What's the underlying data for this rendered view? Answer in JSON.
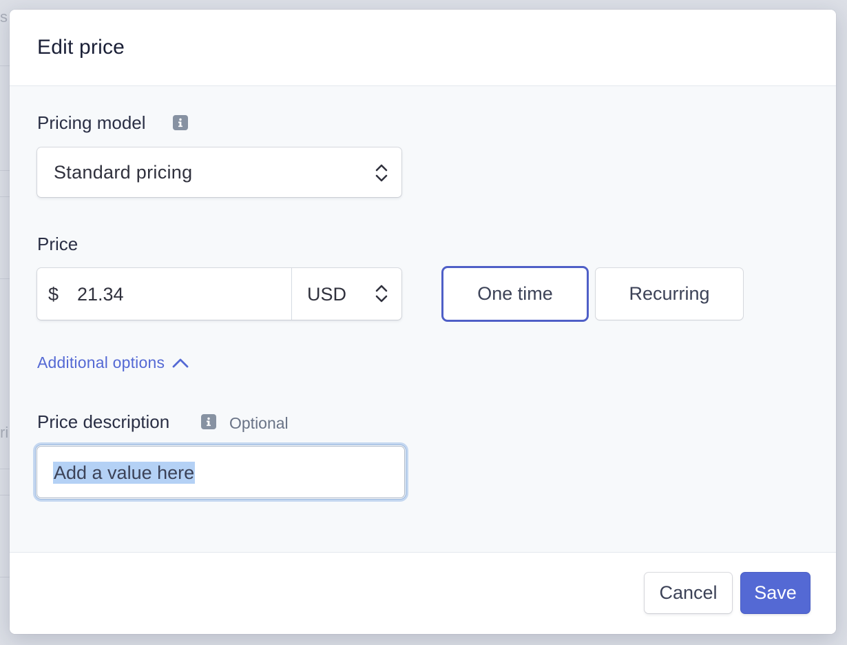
{
  "modal": {
    "title": "Edit price"
  },
  "pricing_model": {
    "label": "Pricing model",
    "info_icon": "info-icon",
    "selected": "Standard pricing"
  },
  "price": {
    "label": "Price",
    "currency_symbol": "$",
    "amount": "21.34",
    "currency": "USD",
    "type_options": [
      {
        "label": "One time",
        "selected": true
      },
      {
        "label": "Recurring",
        "selected": false
      }
    ]
  },
  "additional_options": {
    "label": "Additional options",
    "icon": "chevron-up-icon",
    "expanded": true
  },
  "price_description": {
    "label": "Price description",
    "info_icon": "info-icon",
    "optional_label": "Optional",
    "value": "Add a value here"
  },
  "footer": {
    "cancel_label": "Cancel",
    "save_label": "Save"
  },
  "background": {
    "fragment_1": "s",
    "fragment_2": "ri"
  },
  "colors": {
    "accent": "#5469d4",
    "selected_border": "#4f5fc7",
    "text_primary": "#1a1f36",
    "muted": "#697386",
    "selection_highlight": "#b4d1f5"
  }
}
